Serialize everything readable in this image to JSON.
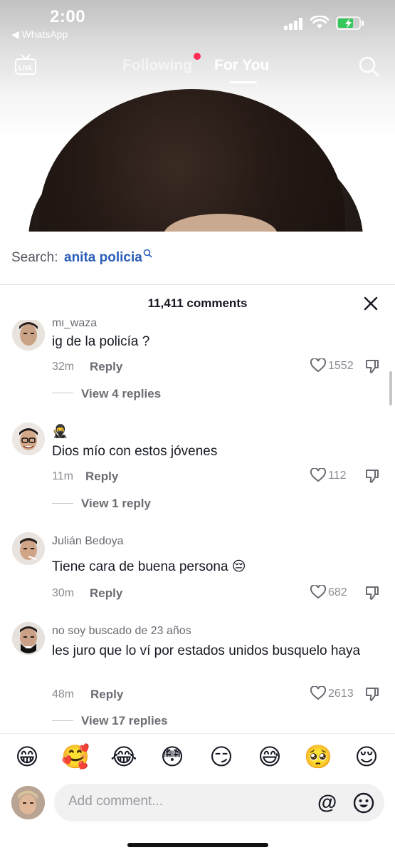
{
  "status_bar": {
    "time": "2:00",
    "back_label": "◀ WhatsApp"
  },
  "top_nav": {
    "following": "Following",
    "for_you": "For You",
    "live_label": "LIVE"
  },
  "search": {
    "label": "Search:",
    "term": "anita policia"
  },
  "comments": {
    "count_label": "11,411 comments",
    "items": [
      {
        "username": "mi_waza",
        "text": "ig de la policía ?",
        "time": "32m",
        "reply": "Reply",
        "likes": "1552",
        "view_replies": "View 4 replies"
      },
      {
        "username": "🥷",
        "text": "Dios mío con estos jóvenes",
        "time": "11m",
        "reply": "Reply",
        "likes": "112",
        "view_replies": "View 1 reply"
      },
      {
        "username": "Julián Bedoya",
        "text": "Tiene cara de buena persona 😔",
        "time": "30m",
        "reply": "Reply",
        "likes": "682",
        "view_replies": ""
      },
      {
        "username": "no soy buscado de 23 años",
        "text": "les juro que lo ví por estados unidos busquelo haya",
        "time": "48m",
        "reply": "Reply",
        "likes": "2613",
        "view_replies": "View 17 replies"
      }
    ]
  },
  "emoji_bar": [
    "😁",
    "🥰",
    "😂",
    "😳",
    "😏",
    "😅",
    "🥺",
    "😌"
  ],
  "input": {
    "placeholder": "Add comment..."
  },
  "colors": {
    "accent": "#fe2c55",
    "link": "#2b5db9"
  }
}
